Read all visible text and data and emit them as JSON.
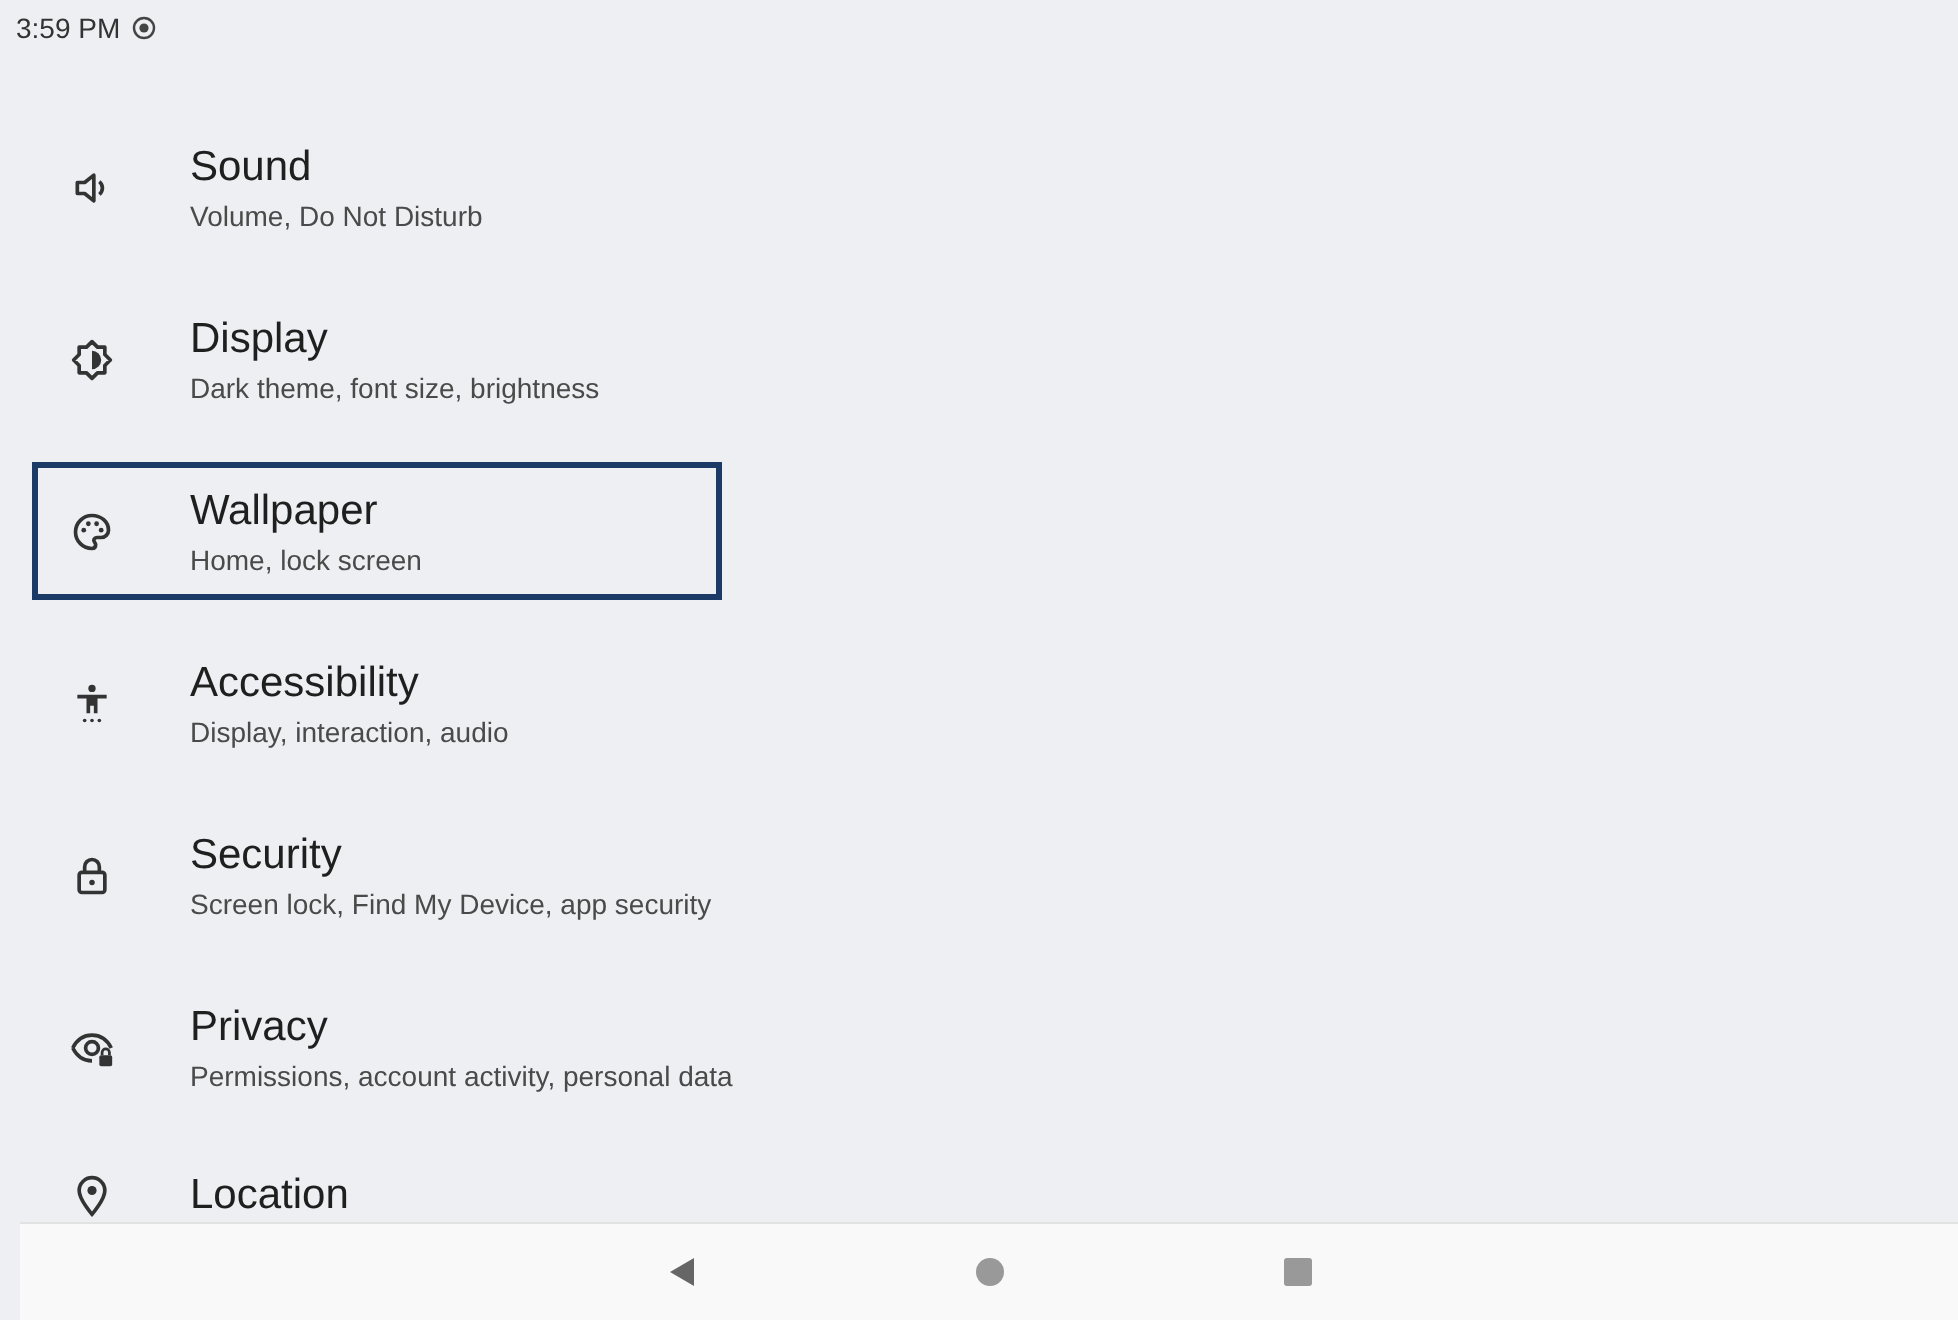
{
  "status_bar": {
    "time": "3:59 PM"
  },
  "settings": [
    {
      "title": "Sound",
      "summary": "Volume, Do Not Disturb",
      "selected": false
    },
    {
      "title": "Display",
      "summary": "Dark theme, font size, brightness",
      "selected": false
    },
    {
      "title": "Wallpaper",
      "summary": "Home, lock screen",
      "selected": true
    },
    {
      "title": "Accessibility",
      "summary": "Display, interaction, audio",
      "selected": false
    },
    {
      "title": "Security",
      "summary": "Screen lock, Find My Device, app security",
      "selected": false
    },
    {
      "title": "Privacy",
      "summary": "Permissions, account activity, personal data",
      "selected": false
    },
    {
      "title": "Location",
      "selected": false
    }
  ]
}
